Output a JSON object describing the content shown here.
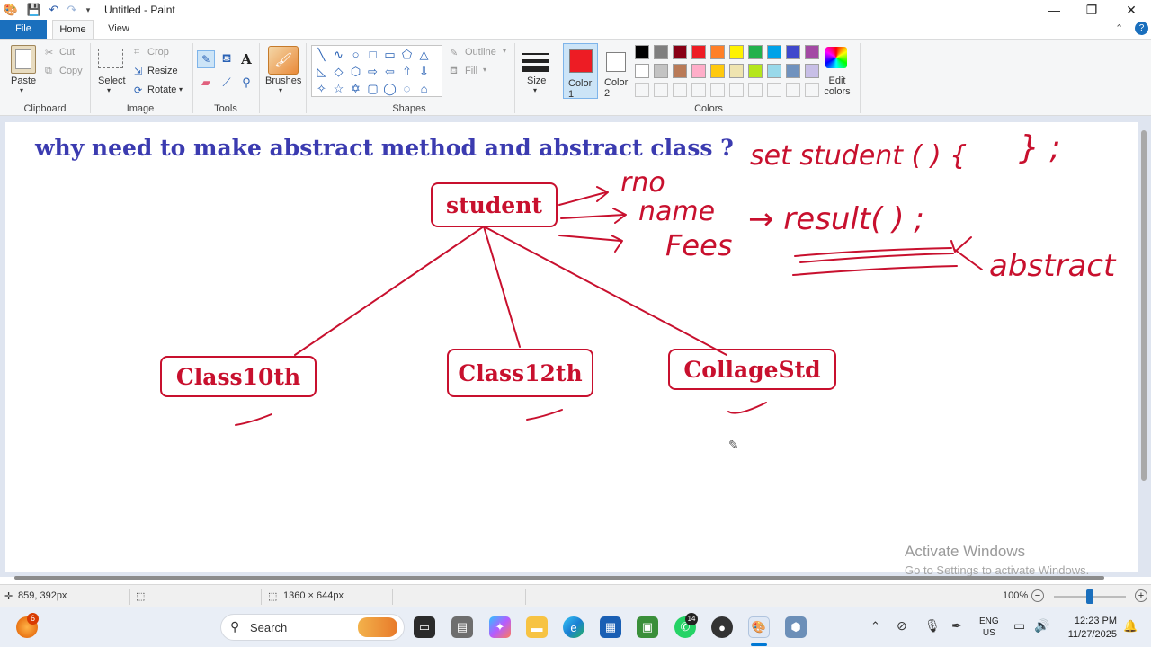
{
  "window": {
    "title": "Untitled - Paint",
    "controls": {
      "minimize": "—",
      "maximize": "❐",
      "close": "✕"
    }
  },
  "tabs": {
    "file": "File",
    "home": "Home",
    "view": "View"
  },
  "ribbon": {
    "clipboard": {
      "label": "Clipboard",
      "paste": "Paste",
      "cut": "Cut",
      "copy": "Copy"
    },
    "image": {
      "label": "Image",
      "select": "Select",
      "crop": "Crop",
      "resize": "Resize",
      "rotate": "Rotate"
    },
    "tools": {
      "label": "Tools"
    },
    "brushes": {
      "label": "Brushes"
    },
    "shapes": {
      "label": "Shapes",
      "outline": "Outline",
      "fill": "Fill"
    },
    "size": {
      "label": "Size"
    },
    "colors": {
      "label": "Colors",
      "color1": "Color 1",
      "color1_line2": "1",
      "color2": "Color 2",
      "color2_line2": "2",
      "color1_value": "#ed1c24",
      "color2_value": "#ffffff",
      "edit_colors": "Edit colors",
      "palette_row1": [
        "#000000",
        "#7f7f7f",
        "#880015",
        "#ed1c24",
        "#ff7f27",
        "#fff200",
        "#22b14c",
        "#00a2e8",
        "#3f48cc",
        "#a349a4"
      ],
      "palette_row2": [
        "#ffffff",
        "#c3c3c3",
        "#b97a57",
        "#ffaec9",
        "#ffc90e",
        "#efe4b0",
        "#b5e61d",
        "#99d9ea",
        "#7092be",
        "#c8bfe7"
      ]
    }
  },
  "canvas": {
    "question": "why need to make abstract method and abstract class ?",
    "boxes": {
      "student": "student",
      "class10": "Class10th",
      "class12": "Class12th",
      "collage": "CollageStd"
    },
    "handwriting": {
      "rno": "rno",
      "name": "name",
      "fees": "Fees",
      "result": "→ result( ) ;",
      "setstudent": "set student ( ) {",
      "brace_close": "} ;",
      "abstract": "abstract"
    },
    "watermark_title": "Activate Windows",
    "watermark_sub": "Go to Settings to activate Windows."
  },
  "statusbar": {
    "cursor_pos": "859, 392px",
    "canvas_size": "1360 × 644px",
    "zoom": "100%"
  },
  "taskbar": {
    "search_placeholder": "Search",
    "notification_badge": "6",
    "whatsapp_badge": "14",
    "lang_top": "ENG",
    "lang_bottom": "US",
    "time": "12:23 PM",
    "date": "11/27/2025"
  }
}
